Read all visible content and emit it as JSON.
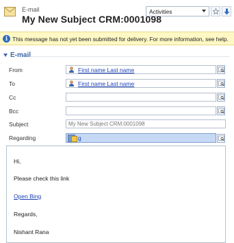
{
  "header": {
    "entity_label": "E-mail",
    "title": "My New Subject CRM:0001098",
    "view_selector": "Activities"
  },
  "notice": {
    "text": "This message has not yet been submitted for delivery. For more information, see help."
  },
  "section": {
    "title": "E-mail"
  },
  "fields": {
    "from": {
      "label": "From",
      "value": "First name Last name"
    },
    "to": {
      "label": "To",
      "value": "First name Last name"
    },
    "cc": {
      "label": "Cc",
      "value": ""
    },
    "bcc": {
      "label": "Bcc",
      "value": ""
    },
    "subject": {
      "label": "Subject",
      "value": "My New Subject CRM:0001098"
    },
    "regarding": {
      "label": "Regarding",
      "value": "g"
    }
  },
  "body": {
    "greeting": "Hi,",
    "line1": "Please check this link",
    "link_text": "Open Bing",
    "closing": "Regards,",
    "signature": "Nishant Rana"
  }
}
